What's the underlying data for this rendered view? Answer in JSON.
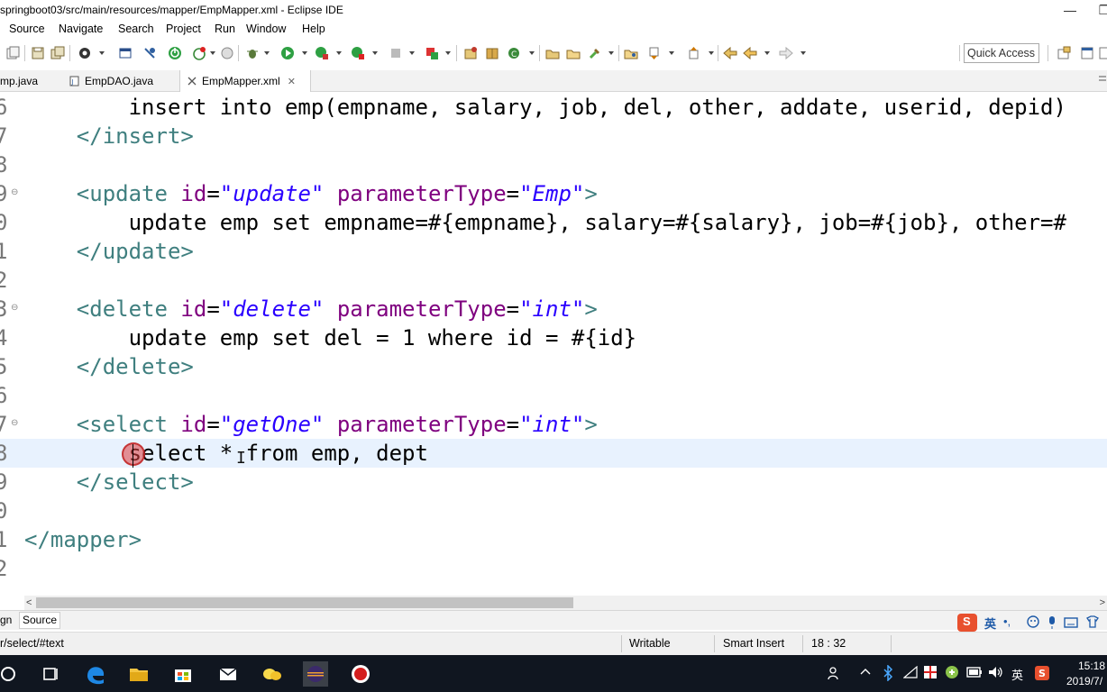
{
  "window": {
    "title": "springboot03/src/main/resources/mapper/EmpMapper.xml - Eclipse IDE",
    "minimize": "—",
    "restore": "❐"
  },
  "menu": [
    "Source",
    "Navigate",
    "Search",
    "Project",
    "Run",
    "Window",
    "Help"
  ],
  "toolbar": {
    "quick_access": "Quick Access"
  },
  "editor_tabs": [
    {
      "label": "mp.java",
      "icon": "java-file-icon",
      "active": false
    },
    {
      "label": "EmpDAO.java",
      "icon": "java-file-icon",
      "active": false
    },
    {
      "label": "EmpMapper.xml",
      "icon": "xml-file-icon",
      "active": true,
      "close": "✕"
    }
  ],
  "code": {
    "lines": [
      {
        "num": "6",
        "text": "        insert into emp(empname, salary, job, del, other, addate, userid, depid)"
      },
      {
        "num": "7",
        "text": "    </insert>"
      },
      {
        "num": "8",
        "text": ""
      },
      {
        "num": "9",
        "text": "    <update id=\"update\" parameterType=\"Emp\">"
      },
      {
        "num": "0",
        "text": "        update emp set empname=#{empname}, salary=#{salary}, job=#{job}, other=#"
      },
      {
        "num": "1",
        "text": "    </update>"
      },
      {
        "num": "2",
        "text": ""
      },
      {
        "num": "3",
        "text": "    <delete id=\"delete\" parameterType=\"int\">"
      },
      {
        "num": "4",
        "text": "        update emp set del = 1 where id = #{id}"
      },
      {
        "num": "5",
        "text": "    </delete>"
      },
      {
        "num": "6",
        "text": ""
      },
      {
        "num": "7",
        "text": "    <select id=\"getOne\" parameterType=\"int\">"
      },
      {
        "num": "8",
        "text": "        select * from emp, dept"
      },
      {
        "num": "9",
        "text": "    </select>"
      },
      {
        "num": "0",
        "text": ""
      },
      {
        "num": "1",
        "text": "</mapper>"
      },
      {
        "num": "2",
        "text": ""
      }
    ],
    "fold_marker": "⊖",
    "colors": {
      "tag": "#3f7f7f",
      "attr": "#7f007f",
      "string": "#2a00ff",
      "current_line": "#e8f2fe"
    }
  },
  "bottom_tabs": [
    {
      "label": "gn",
      "active": false
    },
    {
      "label": "Source",
      "active": true
    }
  ],
  "ime": {
    "logo": "S",
    "lang": "英",
    "punct": "•,",
    "items": [
      "☺",
      "🎤",
      "⌨",
      "👕"
    ]
  },
  "status": {
    "path": "r/select/#text",
    "writable": "Writable",
    "insert_mode": "Smart Insert",
    "position": "18 : 32"
  },
  "tray": {
    "time": "15:18",
    "date": "2019/7/",
    "lang": "英"
  }
}
